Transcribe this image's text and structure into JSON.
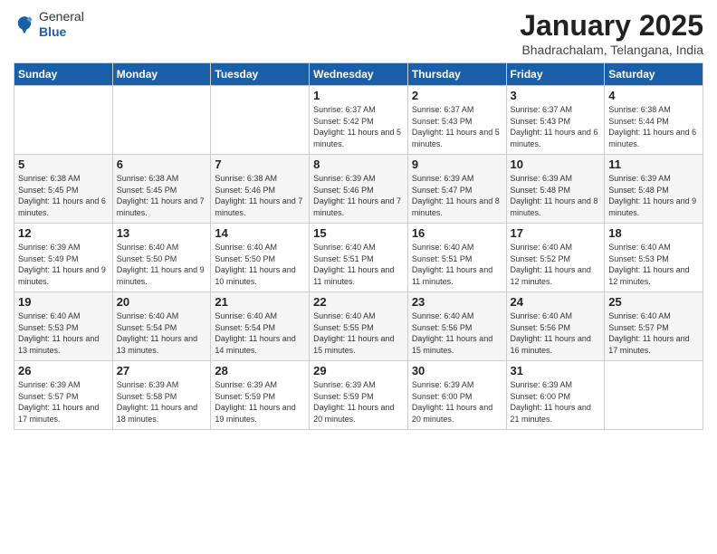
{
  "logo": {
    "general": "General",
    "blue": "Blue"
  },
  "title": "January 2025",
  "subtitle": "Bhadrachalam, Telangana, India",
  "days_of_week": [
    "Sunday",
    "Monday",
    "Tuesday",
    "Wednesday",
    "Thursday",
    "Friday",
    "Saturday"
  ],
  "weeks": [
    [
      {
        "day": "",
        "info": ""
      },
      {
        "day": "",
        "info": ""
      },
      {
        "day": "",
        "info": ""
      },
      {
        "day": "1",
        "info": "Sunrise: 6:37 AM\nSunset: 5:42 PM\nDaylight: 11 hours\nand 5 minutes."
      },
      {
        "day": "2",
        "info": "Sunrise: 6:37 AM\nSunset: 5:43 PM\nDaylight: 11 hours\nand 5 minutes."
      },
      {
        "day": "3",
        "info": "Sunrise: 6:37 AM\nSunset: 5:43 PM\nDaylight: 11 hours\nand 6 minutes."
      },
      {
        "day": "4",
        "info": "Sunrise: 6:38 AM\nSunset: 5:44 PM\nDaylight: 11 hours\nand 6 minutes."
      }
    ],
    [
      {
        "day": "5",
        "info": "Sunrise: 6:38 AM\nSunset: 5:45 PM\nDaylight: 11 hours\nand 6 minutes."
      },
      {
        "day": "6",
        "info": "Sunrise: 6:38 AM\nSunset: 5:45 PM\nDaylight: 11 hours\nand 7 minutes."
      },
      {
        "day": "7",
        "info": "Sunrise: 6:38 AM\nSunset: 5:46 PM\nDaylight: 11 hours\nand 7 minutes."
      },
      {
        "day": "8",
        "info": "Sunrise: 6:39 AM\nSunset: 5:46 PM\nDaylight: 11 hours\nand 7 minutes."
      },
      {
        "day": "9",
        "info": "Sunrise: 6:39 AM\nSunset: 5:47 PM\nDaylight: 11 hours\nand 8 minutes."
      },
      {
        "day": "10",
        "info": "Sunrise: 6:39 AM\nSunset: 5:48 PM\nDaylight: 11 hours\nand 8 minutes."
      },
      {
        "day": "11",
        "info": "Sunrise: 6:39 AM\nSunset: 5:48 PM\nDaylight: 11 hours\nand 9 minutes."
      }
    ],
    [
      {
        "day": "12",
        "info": "Sunrise: 6:39 AM\nSunset: 5:49 PM\nDaylight: 11 hours\nand 9 minutes."
      },
      {
        "day": "13",
        "info": "Sunrise: 6:40 AM\nSunset: 5:50 PM\nDaylight: 11 hours\nand 9 minutes."
      },
      {
        "day": "14",
        "info": "Sunrise: 6:40 AM\nSunset: 5:50 PM\nDaylight: 11 hours\nand 10 minutes."
      },
      {
        "day": "15",
        "info": "Sunrise: 6:40 AM\nSunset: 5:51 PM\nDaylight: 11 hours\nand 11 minutes."
      },
      {
        "day": "16",
        "info": "Sunrise: 6:40 AM\nSunset: 5:51 PM\nDaylight: 11 hours\nand 11 minutes."
      },
      {
        "day": "17",
        "info": "Sunrise: 6:40 AM\nSunset: 5:52 PM\nDaylight: 11 hours\nand 12 minutes."
      },
      {
        "day": "18",
        "info": "Sunrise: 6:40 AM\nSunset: 5:53 PM\nDaylight: 11 hours\nand 12 minutes."
      }
    ],
    [
      {
        "day": "19",
        "info": "Sunrise: 6:40 AM\nSunset: 5:53 PM\nDaylight: 11 hours\nand 13 minutes."
      },
      {
        "day": "20",
        "info": "Sunrise: 6:40 AM\nSunset: 5:54 PM\nDaylight: 11 hours\nand 13 minutes."
      },
      {
        "day": "21",
        "info": "Sunrise: 6:40 AM\nSunset: 5:54 PM\nDaylight: 11 hours\nand 14 minutes."
      },
      {
        "day": "22",
        "info": "Sunrise: 6:40 AM\nSunset: 5:55 PM\nDaylight: 11 hours\nand 15 minutes."
      },
      {
        "day": "23",
        "info": "Sunrise: 6:40 AM\nSunset: 5:56 PM\nDaylight: 11 hours\nand 15 minutes."
      },
      {
        "day": "24",
        "info": "Sunrise: 6:40 AM\nSunset: 5:56 PM\nDaylight: 11 hours\nand 16 minutes."
      },
      {
        "day": "25",
        "info": "Sunrise: 6:40 AM\nSunset: 5:57 PM\nDaylight: 11 hours\nand 17 minutes."
      }
    ],
    [
      {
        "day": "26",
        "info": "Sunrise: 6:39 AM\nSunset: 5:57 PM\nDaylight: 11 hours\nand 17 minutes."
      },
      {
        "day": "27",
        "info": "Sunrise: 6:39 AM\nSunset: 5:58 PM\nDaylight: 11 hours\nand 18 minutes."
      },
      {
        "day": "28",
        "info": "Sunrise: 6:39 AM\nSunset: 5:59 PM\nDaylight: 11 hours\nand 19 minutes."
      },
      {
        "day": "29",
        "info": "Sunrise: 6:39 AM\nSunset: 5:59 PM\nDaylight: 11 hours\nand 20 minutes."
      },
      {
        "day": "30",
        "info": "Sunrise: 6:39 AM\nSunset: 6:00 PM\nDaylight: 11 hours\nand 20 minutes."
      },
      {
        "day": "31",
        "info": "Sunrise: 6:39 AM\nSunset: 6:00 PM\nDaylight: 11 hours\nand 21 minutes."
      },
      {
        "day": "",
        "info": ""
      }
    ]
  ]
}
